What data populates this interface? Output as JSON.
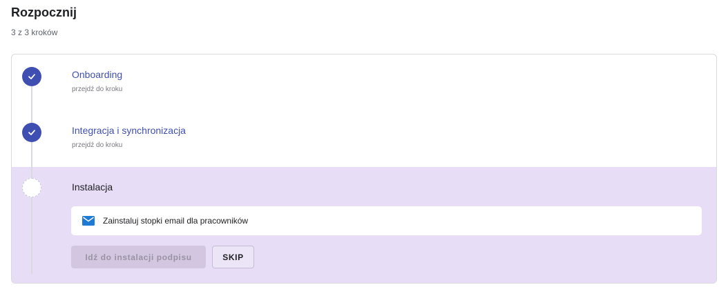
{
  "header": {
    "title": "Rozpocznij",
    "progress_text": "3 z 3 kroków"
  },
  "steps": [
    {
      "title": "Onboarding",
      "link": "przejdź do kroku",
      "status": "done",
      "icon": "check-icon"
    },
    {
      "title": "Integracja i synchronizacja",
      "link": "przejdź do kroku",
      "status": "done",
      "icon": "check-icon"
    },
    {
      "title": "Instalacja",
      "status": "current",
      "task": {
        "icon": "envelope-icon",
        "text": "Zainstaluj stopki email dla pracowników"
      },
      "primary_button": "Idź do instalacji podpisu",
      "secondary_button": "SKIP"
    }
  ],
  "colors": {
    "accent": "#3f4fb1",
    "active_bg": "#e7ddf6",
    "mail_icon": "#1f7ad6"
  }
}
